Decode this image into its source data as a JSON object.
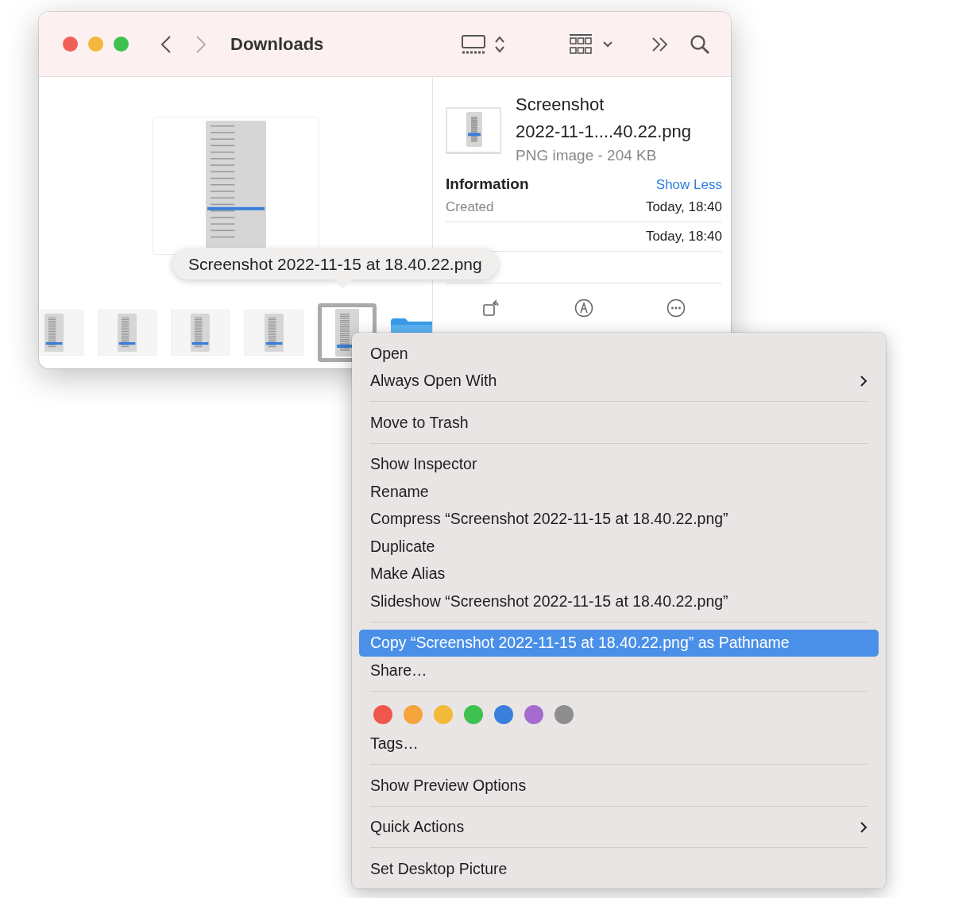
{
  "window": {
    "title": "Downloads",
    "back": {
      "disabled": false
    },
    "forward": {
      "disabled": true
    }
  },
  "gallery": {
    "preview": {
      "kind": "document"
    },
    "thumbnails": [
      {
        "kind": "image",
        "selected": false
      },
      {
        "kind": "image",
        "selected": false
      },
      {
        "kind": "image",
        "selected": false
      },
      {
        "kind": "image",
        "selected": false
      },
      {
        "kind": "image",
        "selected": true
      },
      {
        "kind": "folder",
        "selected": false
      }
    ]
  },
  "tooltip": "Screenshot 2022-11-15 at 18.40.22.png",
  "inspector": {
    "file_name": "Screenshot 2022-11-1....40.22.png",
    "file_info": "PNG image - 204 KB",
    "section_title": "Information",
    "toggle_link": "Show Less",
    "rows": [
      {
        "label": "Created",
        "value": "Today, 18:40"
      },
      {
        "value": "Today, 18:40"
      }
    ]
  },
  "context_menu": {
    "sections": [
      [
        {
          "label": "Open",
          "selected": false,
          "submenu": false
        },
        {
          "label": "Always Open With",
          "selected": false,
          "submenu": true
        }
      ],
      [
        {
          "label": "Move to Trash",
          "selected": false,
          "submenu": false
        }
      ],
      [
        {
          "label": "Show Inspector",
          "selected": false,
          "submenu": false
        },
        {
          "label": "Rename",
          "selected": false,
          "submenu": false
        },
        {
          "label": "Compress “Screenshot 2022-11-15 at 18.40.22.png”",
          "selected": false,
          "submenu": false
        },
        {
          "label": "Duplicate",
          "selected": false,
          "submenu": false
        },
        {
          "label": "Make Alias",
          "selected": false,
          "submenu": false
        },
        {
          "label": "Slideshow “Screenshot 2022-11-15 at 18.40.22.png”",
          "selected": false,
          "submenu": false
        }
      ],
      [
        {
          "label": "Copy “Screenshot 2022-11-15 at 18.40.22.png” as Pathname",
          "selected": true,
          "submenu": false
        },
        {
          "label": "Share…",
          "selected": false,
          "submenu": false
        }
      ],
      [
        {
          "kind": "tags",
          "colors": [
            {
              "color": "#f0564c"
            },
            {
              "color": "#f5a33a"
            },
            {
              "color": "#f5b93a"
            },
            {
              "color": "#3ec150"
            },
            {
              "color": "#3a7fdc"
            },
            {
              "color": "#a66bcf"
            },
            {
              "color": "#8e8e8e"
            }
          ]
        },
        {
          "label": "Tags…",
          "selected": false,
          "submenu": false
        }
      ],
      [
        {
          "label": "Show Preview Options",
          "selected": false,
          "submenu": false
        }
      ],
      [
        {
          "label": "Quick Actions",
          "selected": false,
          "submenu": true
        }
      ],
      [
        {
          "label": "Set Desktop Picture",
          "selected": false,
          "submenu": false
        }
      ]
    ]
  }
}
